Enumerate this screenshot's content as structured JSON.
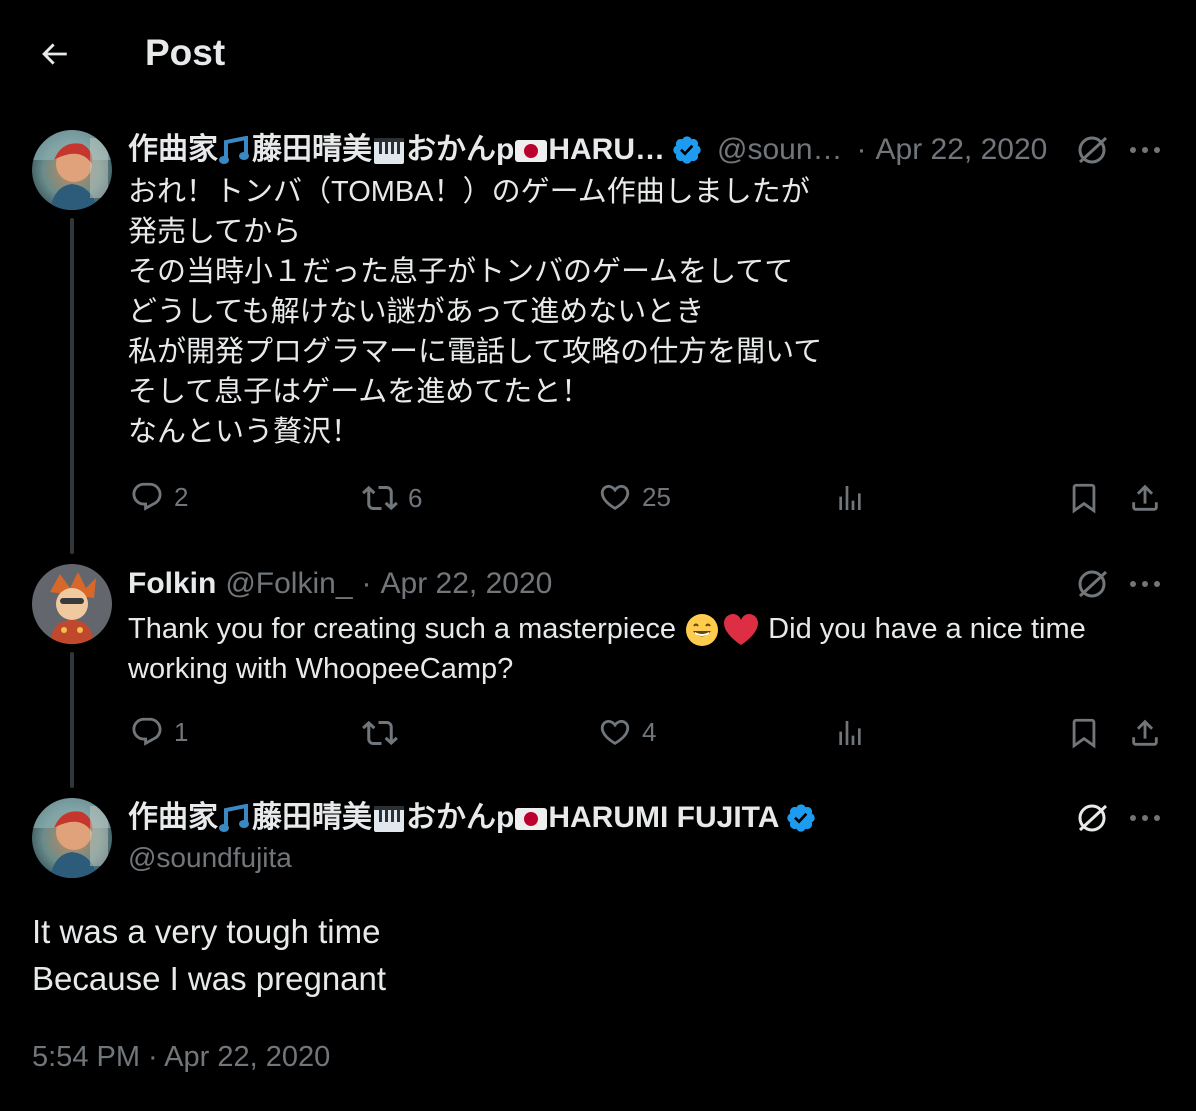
{
  "header": {
    "title": "Post"
  },
  "tweets": [
    {
      "display_name": "作曲家",
      "name_part2": "藤田晴美",
      "name_part3": "おかんp",
      "name_part4": "HARU…",
      "handle": "@soun…",
      "separator": "·",
      "date": "Apr 22, 2020",
      "text": "おれ！トンバ（TOMBA！）のゲーム作曲しましたが\n発売してから\nその当時小１だった息子がトンバのゲームをしてて\nどうしても解けない謎があって進めないとき\n私が開発プログラマーに電話して攻略の仕方を聞いて\nそして息子はゲームを進めてたと！\nなんという贅沢！",
      "actions": {
        "replies": "2",
        "reposts": "6",
        "likes": "25"
      }
    },
    {
      "display_name": "Folkin",
      "handle": "@Folkin_",
      "separator": "·",
      "date": "Apr 22, 2020",
      "text_part1": "Thank you for creating such a masterpiece ",
      "text_part2": " Did you have a nice time",
      "text_line2": "working with WhoopeeCamp?",
      "actions": {
        "replies": "1",
        "reposts": "",
        "likes": "4"
      }
    },
    {
      "display_name": "作曲家",
      "name_part2": "藤田晴美",
      "name_part3": "おかんp",
      "name_part4": "HARUMI FUJITA",
      "handle": "@soundfujita",
      "text_line1": "It was a very tough time",
      "text_line2": "Because I was pregnant",
      "timestamp": "5:54 PM · Apr 22, 2020"
    }
  ],
  "colors": {
    "background": "#000000",
    "text": "#e7e9ea",
    "muted": "#71767b",
    "verified": "#1d9bf0",
    "thread_line": "#333639"
  }
}
